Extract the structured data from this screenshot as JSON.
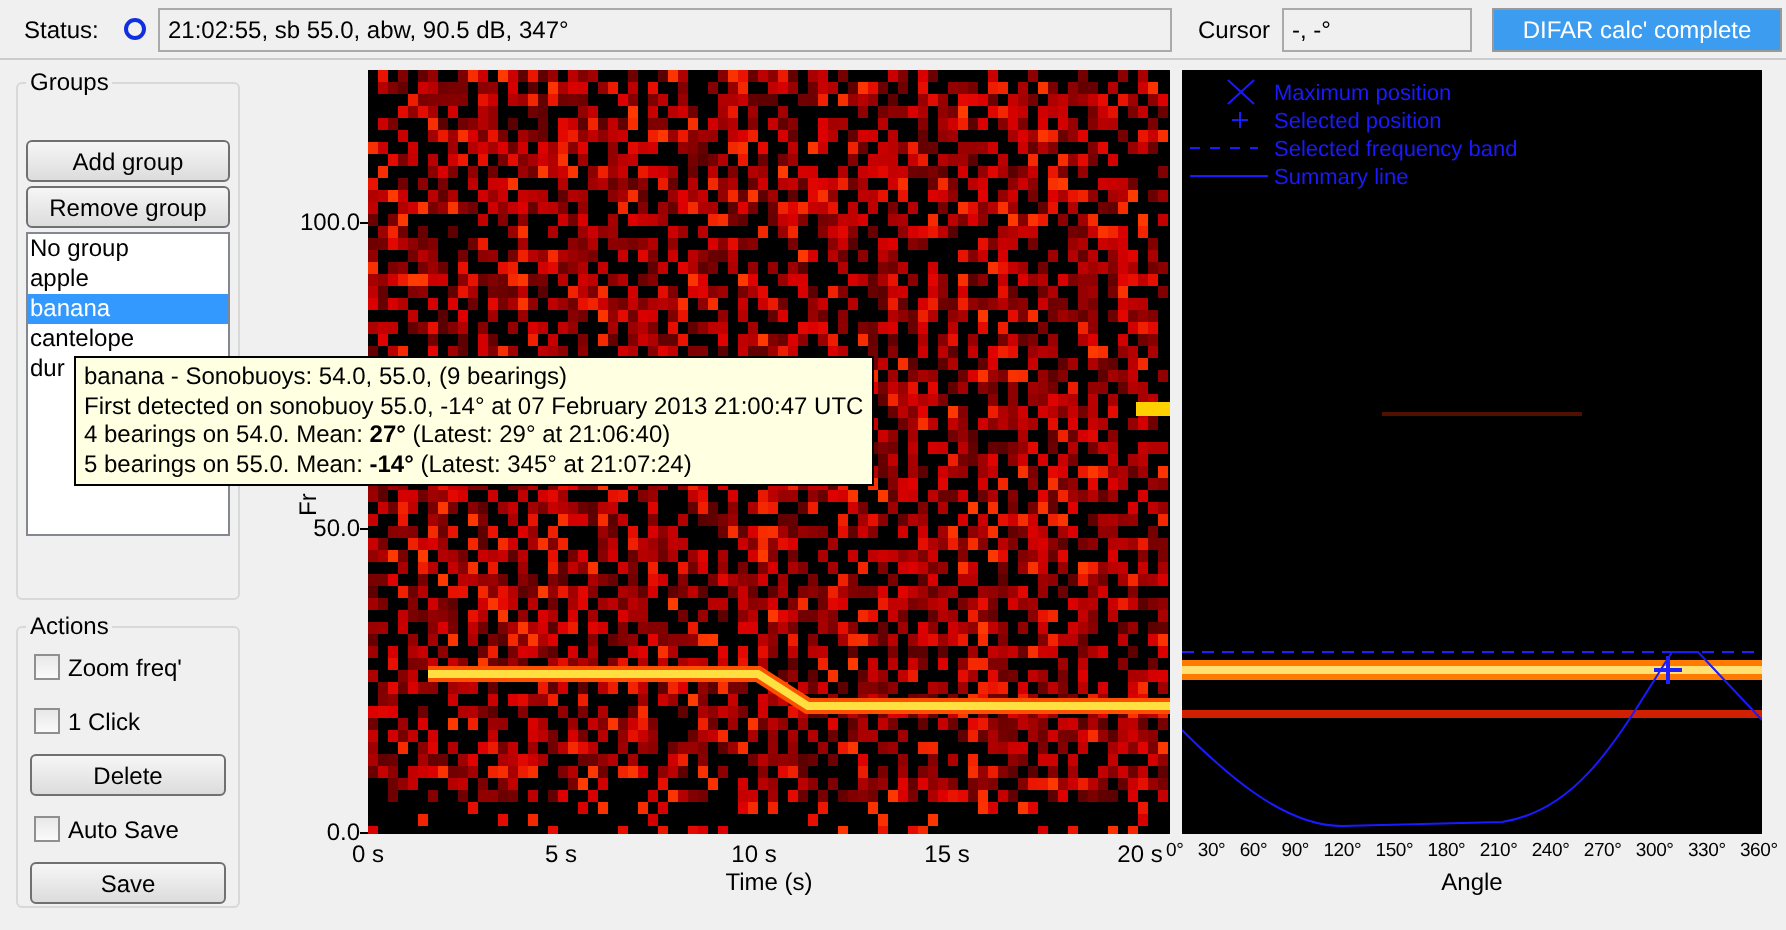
{
  "status_bar": {
    "label": "Status:",
    "value": "21:02:55, sb 55.0, abw, 90.5 dB, 347°",
    "cursor_label": "Cursor",
    "cursor_value": "-, -°",
    "progress": {
      "text": "DIFAR calc' complete",
      "level": 1
    }
  },
  "groups": {
    "title": "Groups",
    "buttons": [
      "Add group",
      "Remove group"
    ],
    "items": [
      {
        "label": "No group",
        "selected": false
      },
      {
        "label": "apple",
        "selected": false
      },
      {
        "label": "banana",
        "selected": true
      },
      {
        "label": "cantelope",
        "selected": false
      },
      {
        "label": "dur",
        "selected": false
      }
    ]
  },
  "actions": {
    "title": "Actions",
    "items": [
      {
        "kind": "checkbox",
        "label": "Zoom freq'",
        "checked": false
      },
      {
        "kind": "checkbox",
        "label": "1 Click",
        "checked": false
      },
      {
        "kind": "button",
        "label": "Delete"
      },
      {
        "kind": "checkbox",
        "label": "Auto Save",
        "checked": false
      },
      {
        "kind": "button",
        "label": "Save"
      }
    ]
  },
  "spectrogram": {
    "yticks": [
      "100.0",
      "50.0",
      "0.0"
    ],
    "ylabel": "Fr",
    "xticks": [
      "0 s",
      "5 s",
      "10 s",
      "15 s",
      "20 s"
    ],
    "xlabel": "Time (s)"
  },
  "angle_plot": {
    "legend": [
      {
        "kind": "cross",
        "label": "Maximum position"
      },
      {
        "kind": "plus",
        "label": "Selected position"
      },
      {
        "kind": "dashed",
        "label": "Selected frequency band"
      },
      {
        "kind": "solid",
        "label": "Summary line"
      }
    ],
    "xticks": [
      "0°",
      "30°",
      "60°",
      "90°",
      "120°",
      "150°",
      "180°",
      "210°",
      "240°",
      "270°",
      "300°",
      "330°",
      "360°"
    ],
    "xlabel": "Angle"
  },
  "tooltip": {
    "lines": [
      "banana - Sonobuoys: 54.0, 55.0, (9 bearings)",
      "First detected on sonobuoy 55.0, -14° at 07 February 2013 21:00:47 UTC",
      "4 bearings on 54.0. Mean: **27°** (Latest: 29° at 21:06:40)",
      "5 bearings on 55.0. Mean: **-14°** (Latest: 345° at 21:07:24)"
    ]
  }
}
